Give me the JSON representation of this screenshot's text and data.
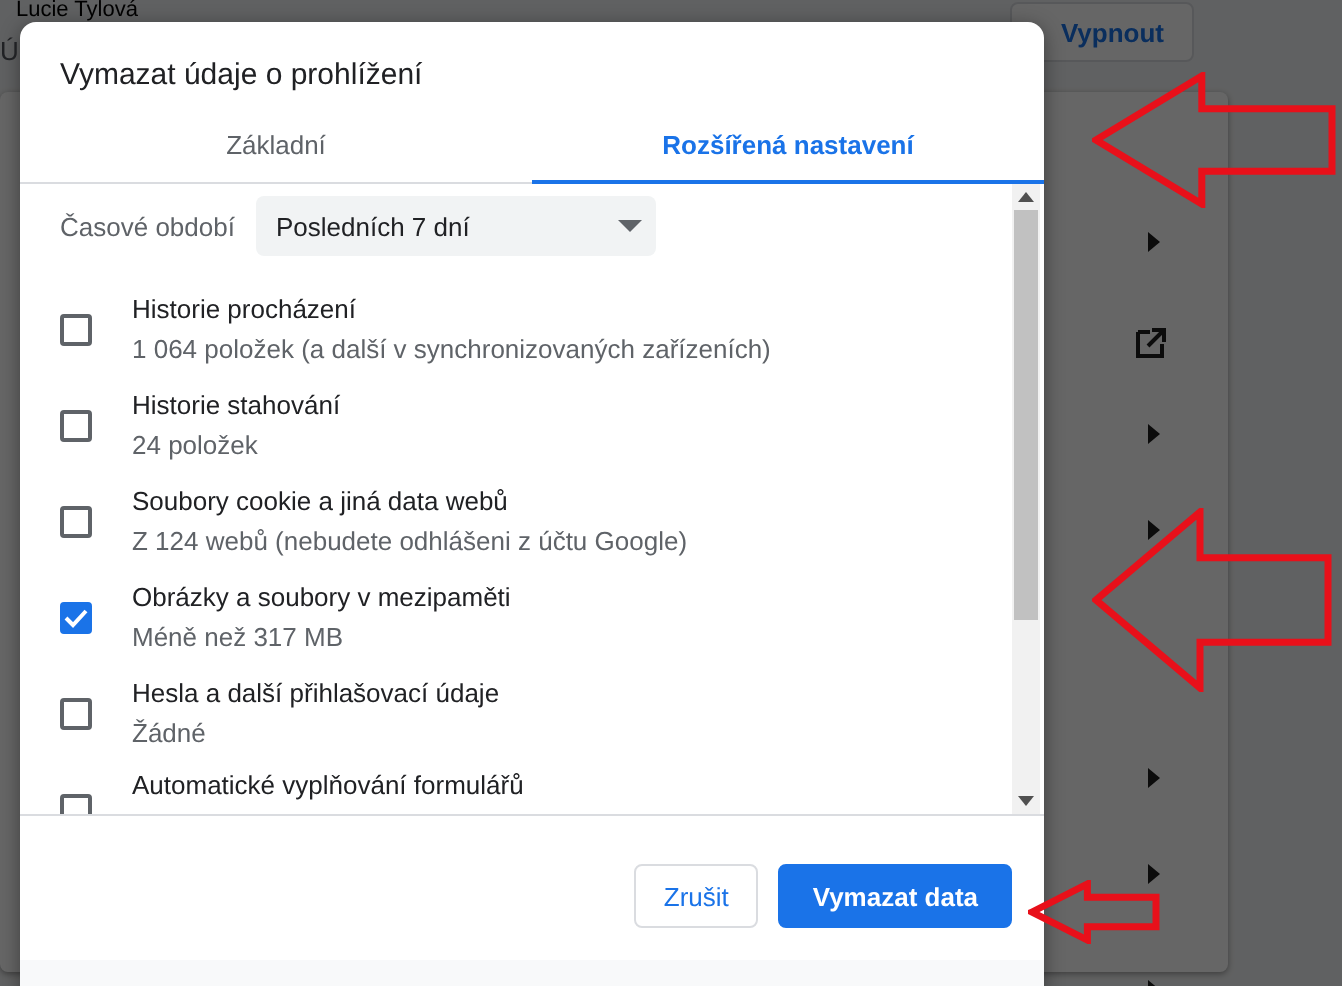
{
  "background": {
    "profile_name": "Lucie Tylová",
    "turn_off_button": "Vypnout",
    "left_fragments": [
      "Ú"
    ],
    "rows": [
      {
        "kind": "chevron"
      },
      {
        "kind": "external"
      },
      {
        "kind": "chevron"
      },
      {
        "kind": "chevron"
      },
      {
        "kind": "chevron"
      },
      {
        "kind": "chevron"
      },
      {
        "kind": "chevron"
      }
    ]
  },
  "dialog": {
    "title": "Vymazat údaje o prohlížení",
    "tabs": [
      {
        "label": "Základní",
        "selected": false
      },
      {
        "label": "Rozšířená nastavení",
        "selected": true
      }
    ],
    "time_range": {
      "label": "Časové období",
      "value": "Posledních 7 dní"
    },
    "items": [
      {
        "title": "Historie procházení",
        "detail": "1 064 položek (a další v synchronizovaných zařízeních)",
        "checked": false
      },
      {
        "title": "Historie stahování",
        "detail": "24 položek",
        "checked": false
      },
      {
        "title": "Soubory cookie a jiná data webů",
        "detail": "Z 124 webů (nebudete odhlášeni z účtu Google)",
        "checked": false
      },
      {
        "title": "Obrázky a soubory v mezipaměti",
        "detail": "Méně než 317 MB",
        "checked": true
      },
      {
        "title": "Hesla a další přihlašovací údaje",
        "detail": "Žádné",
        "checked": false
      },
      {
        "title": "Automatické vyplňování formulářů",
        "checked": false
      }
    ],
    "buttons": [
      {
        "label": "Zrušit",
        "kind": "secondary"
      },
      {
        "label": "Vymazat data",
        "kind": "primary"
      }
    ]
  },
  "annotations": [
    {
      "kind": "arrow"
    },
    {
      "kind": "arrow"
    },
    {
      "kind": "arrow"
    }
  ]
}
